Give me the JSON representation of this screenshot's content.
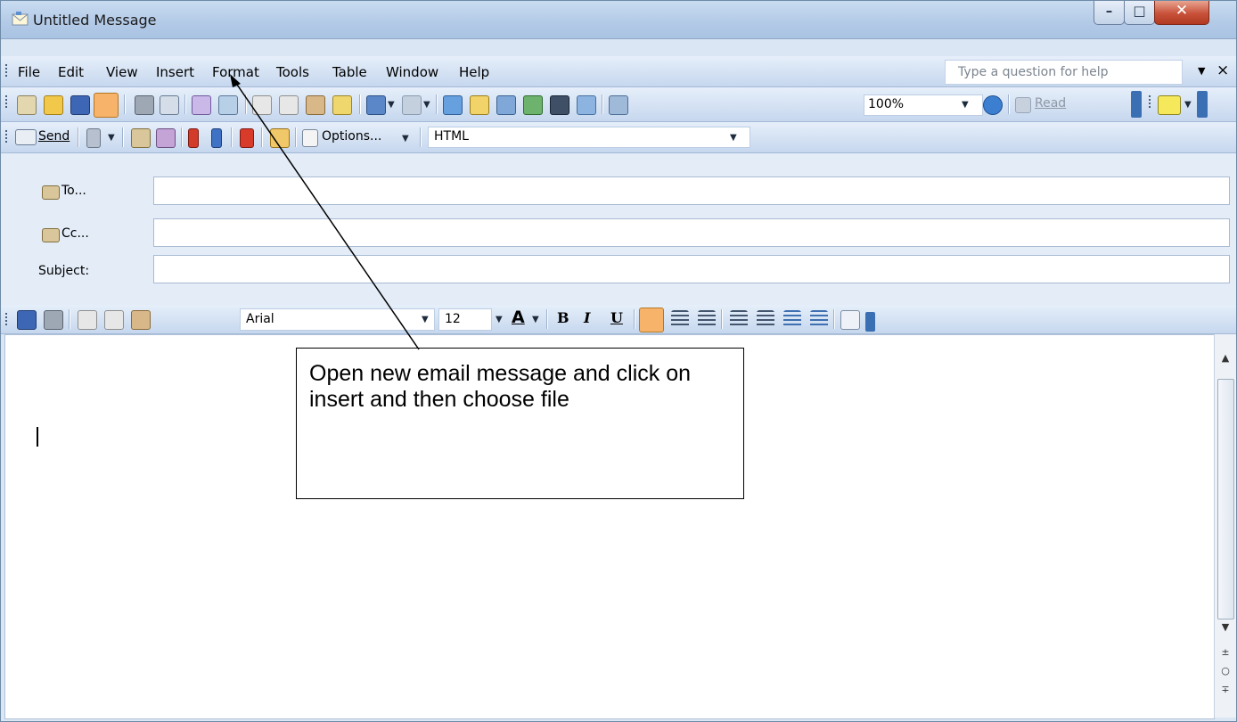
{
  "window": {
    "title": "Untitled Message",
    "minimize_glyph": "–",
    "maximize_glyph": "□",
    "close_glyph": "✕"
  },
  "menu": {
    "items": [
      "File",
      "Edit",
      "View",
      "Insert",
      "Format",
      "Tools",
      "Table",
      "Window",
      "Help"
    ],
    "help_placeholder": "Type a question for help",
    "help_dropdown": "▼",
    "close_glyph": "×"
  },
  "standard_toolbar": {
    "zoom": "100%",
    "read_label": "Read"
  },
  "message_toolbar": {
    "send_label": "Send",
    "options_label": "Options...",
    "format_value": "HTML"
  },
  "header": {
    "to_label": "To...",
    "cc_label": "Cc...",
    "subject_label": "Subject:",
    "to_value": "",
    "cc_value": "",
    "subject_value": ""
  },
  "formatting_toolbar": {
    "font": "Arial",
    "size": "12",
    "bold": "B",
    "italic": "I",
    "underline": "U",
    "font_color_glyph": "A"
  },
  "annotation": {
    "callout_text": "Open new email message and click on insert and then choose file"
  },
  "colors": {
    "accent": "#f7b36a",
    "toolbar": "#c6d7ee",
    "title_bar": "#b4cbe7",
    "close_button": "#c8513a"
  }
}
